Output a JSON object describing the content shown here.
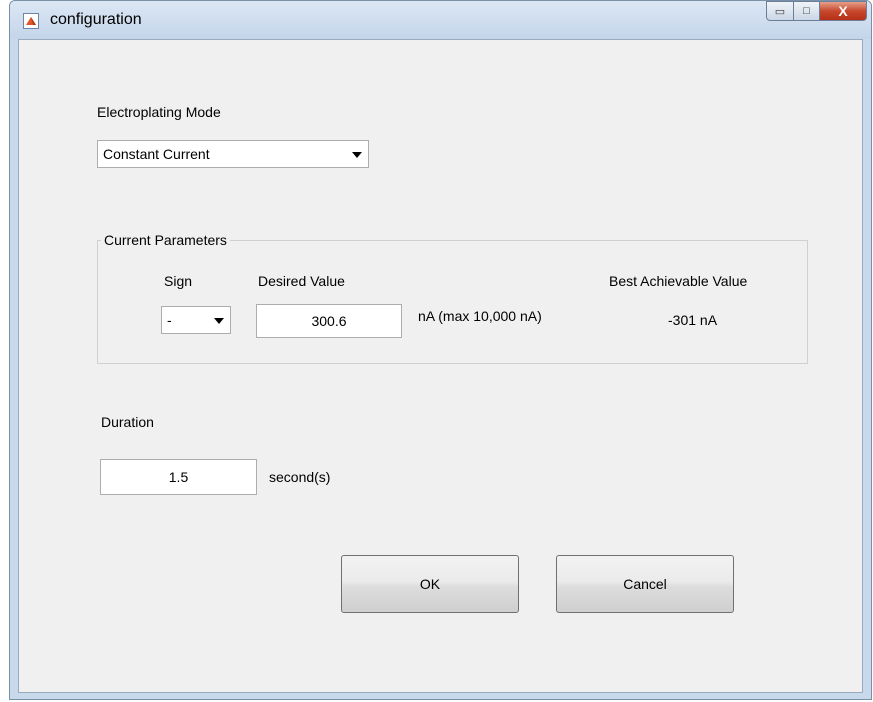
{
  "window": {
    "title": "configuration",
    "minimize_glyph": "▭",
    "maximize_glyph": "□",
    "close_glyph": "X"
  },
  "icons": {
    "app": "matlab-logo-icon",
    "minimize": "minimize-icon",
    "maximize": "maximize-icon",
    "close": "close-icon",
    "dropdown": "dropdown-arrow-icon"
  },
  "mode": {
    "label": "Electroplating Mode",
    "selected": "Constant Current"
  },
  "current": {
    "group_title": "Current Parameters",
    "sign_label": "Sign",
    "sign_value": "-",
    "desired_label": "Desired Value",
    "desired_value": "300.6",
    "unit_note": "nA (max 10,000 nA)",
    "best_label": "Best Achievable Value",
    "best_value": "-301 nA"
  },
  "duration": {
    "label": "Duration",
    "value": "1.5",
    "unit": "second(s)"
  },
  "buttons": {
    "ok": "OK",
    "cancel": "Cancel"
  },
  "colors": {
    "titlebar": "#c9d9ec",
    "client": "#f0f0f0",
    "close_button": "#c7482d"
  }
}
